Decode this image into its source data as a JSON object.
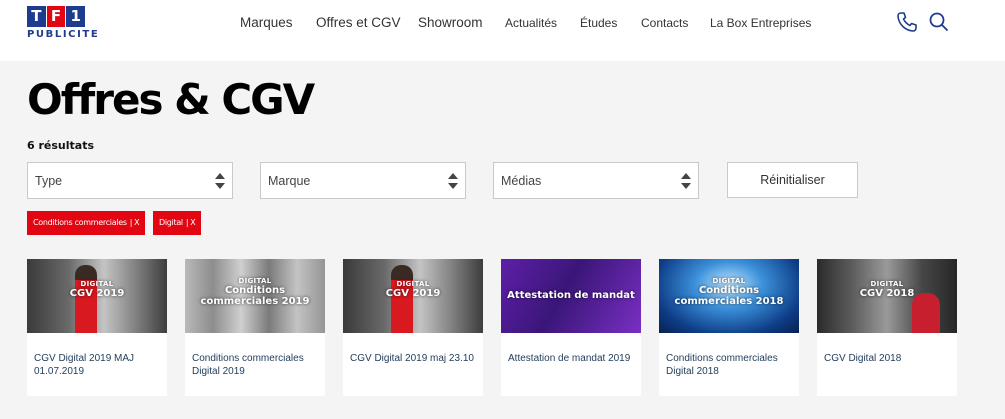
{
  "header": {
    "logo": {
      "tiles": [
        "T",
        "F",
        "1"
      ],
      "sub": "PUBLICITE"
    },
    "nav": [
      "Marques",
      "Offres et CGV",
      "Showroom",
      "Actualités",
      "Études",
      "Contacts",
      "La Box Entreprises"
    ],
    "icons": [
      "phone-icon",
      "search-icon"
    ]
  },
  "page": {
    "title": "Offres & CGV",
    "results": "6 résultats"
  },
  "filters": {
    "selects": [
      {
        "label": "Type"
      },
      {
        "label": "Marque"
      },
      {
        "label": "Médias"
      }
    ],
    "reset_label": "Réinitialiser",
    "active_tags": [
      {
        "label": "Conditions commerciales",
        "close": "X"
      },
      {
        "label": "Digital",
        "close": "X"
      }
    ]
  },
  "cards": [
    {
      "kicker": "DIGITAL",
      "title": "CGV 2019",
      "label": "CGV Digital 2019 MAJ 01.07.2019"
    },
    {
      "kicker": "DIGITAL",
      "title": "Conditions commerciales 2019",
      "label": "Conditions commerciales Digital 2019"
    },
    {
      "kicker": "DIGITAL",
      "title": "CGV 2019",
      "label": "CGV Digital 2019 maj 23.10"
    },
    {
      "kicker": "",
      "title": "Attestation de mandat",
      "label": "Attestation de mandat 2019"
    },
    {
      "kicker": "DIGITAL",
      "title": "Conditions commerciales 2018",
      "label": "Conditions commerciales Digital 2018"
    },
    {
      "kicker": "DIGITAL",
      "title": "CGV 2018",
      "label": "CGV Digital 2018"
    }
  ],
  "colors": {
    "brand_red": "#e20613",
    "brand_blue": "#1d3c8f",
    "link_text": "#1f3b59"
  }
}
